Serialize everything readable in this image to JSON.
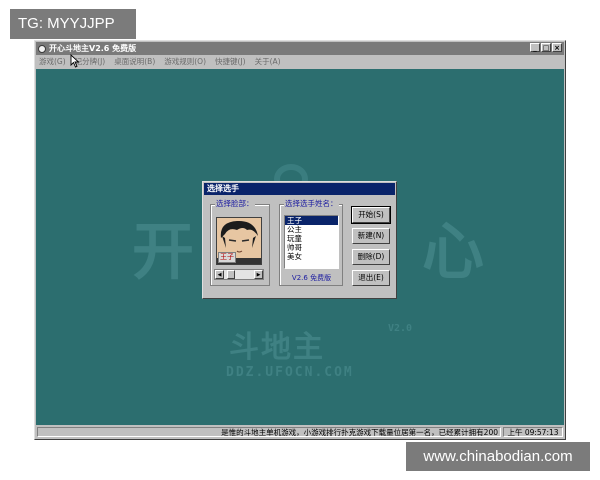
{
  "overlay": {
    "top_tag": "TG: MYYJJPP",
    "bottom_tag": "www.chinabodian.com"
  },
  "window": {
    "title": "开心斗地主V2.6 免费版",
    "controls": [
      "_",
      "□",
      "×"
    ]
  },
  "menu": [
    {
      "label": "游戏(G)"
    },
    {
      "label": "记分牌(J)"
    },
    {
      "label": "桌面说明(B)"
    },
    {
      "label": "游戏规则(O)"
    },
    {
      "label": "快捷键(J)"
    },
    {
      "label": "关于(A)"
    }
  ],
  "watermark": {
    "left_char": "开",
    "right_char": "心",
    "sub": "斗地主",
    "version": "V2.0",
    "url": "DDZ.UFOCN.COM"
  },
  "dialog": {
    "title": "选择选手",
    "avatar_group_label": "选择脸部：",
    "avatar_badge": "王子",
    "name_group_label": "选择选手姓名：",
    "names": [
      "王子",
      "公主",
      "玩童",
      "帅哥",
      "美女"
    ],
    "selected_index": 0,
    "version_label": "V2.6 免费版",
    "buttons": {
      "start": "开始(S)",
      "new": "新建(N)",
      "delete": "删除(D)",
      "exit": "退出(E)"
    }
  },
  "status": {
    "message": "是惟的斗地主单机游戏，小游戏排行扑克游戏下载量位居第一名，已经累计拥有200",
    "time": "上午 09:57:13"
  },
  "colors": {
    "desktop": "#2c6e6f",
    "watermark": "#3f8183",
    "title_bar": "#7a7a7a",
    "dialog_title": "#0a246a"
  }
}
